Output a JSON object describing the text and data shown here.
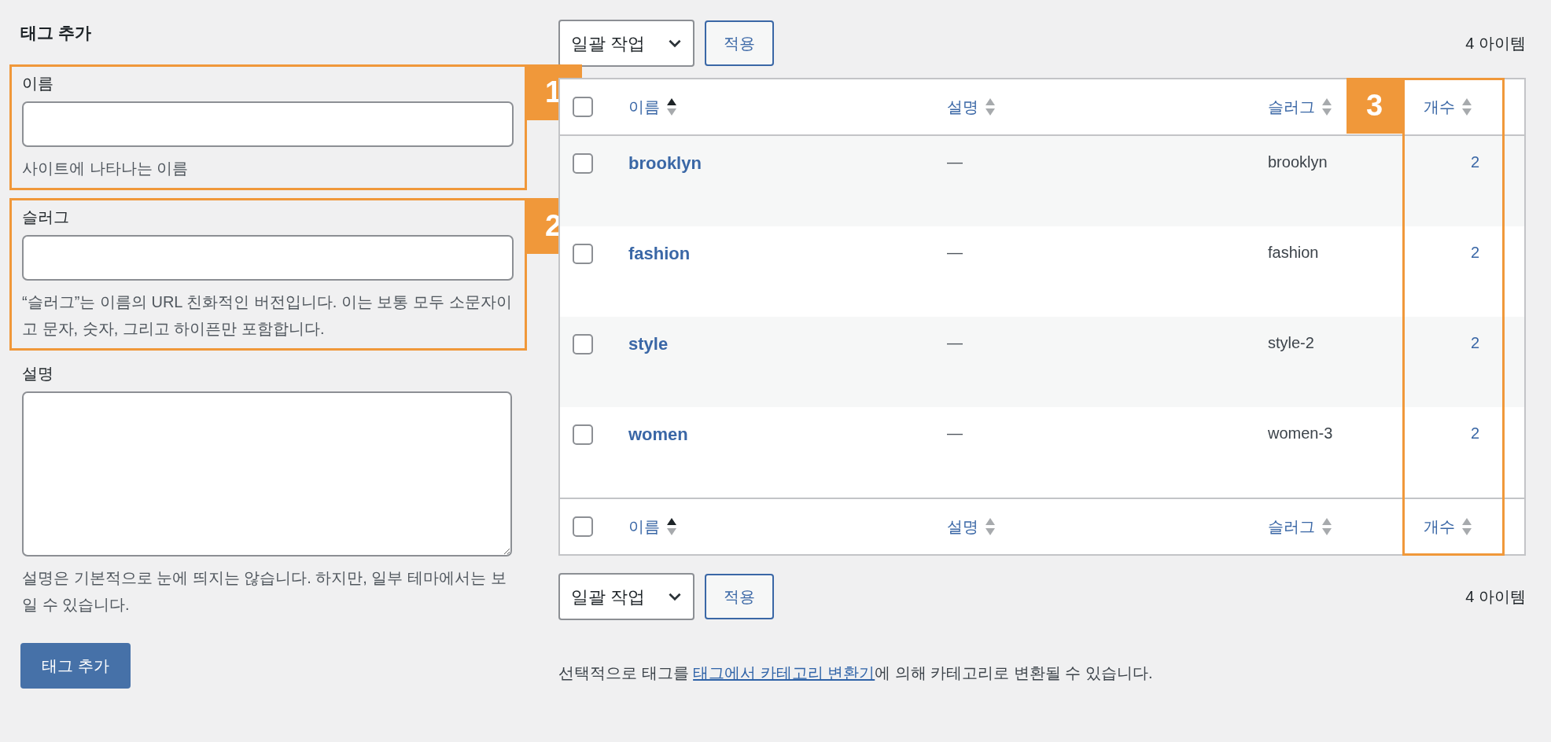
{
  "form": {
    "title": "태그 추가",
    "fields": [
      {
        "kind": "input",
        "label": "이름",
        "help": "사이트에 나타나는 이름",
        "annotation": "1"
      },
      {
        "kind": "input",
        "label": "슬러그",
        "help": "“슬러그”는 이름의 URL 친화적인 버전입니다. 이는 보통 모두 소문자이고 문자, 숫자, 그리고 하이픈만 포함합니다.",
        "annotation": "2"
      },
      {
        "kind": "textarea",
        "label": "설명",
        "help": "설명은 기본적으로 눈에 띄지는 않습니다. 하지만, 일부 테마에서는 보일 수 있습니다."
      }
    ],
    "submit": "태그 추가"
  },
  "top_nav": {
    "bulk_action": "일괄 작업",
    "apply": "적용",
    "count": "4 아이템"
  },
  "table": {
    "annotation": "3",
    "header": [
      {
        "label": "이름",
        "sort_active": true
      },
      {
        "label": "설명",
        "sort_active": false
      },
      {
        "label": "슬러그",
        "sort_active": false
      },
      {
        "label": "개수",
        "sort_active": false
      }
    ],
    "header_checked": false,
    "rows": [
      {
        "checked": false,
        "name": "brooklyn",
        "description": "—",
        "slug": "brooklyn",
        "count": "2"
      },
      {
        "checked": false,
        "name": "fashion",
        "description": "—",
        "slug": "fashion",
        "count": "2"
      },
      {
        "checked": false,
        "name": "style",
        "description": "—",
        "slug": "style-2",
        "count": "2"
      },
      {
        "checked": false,
        "name": "women",
        "description": "—",
        "slug": "women-3",
        "count": "2"
      }
    ],
    "footer": [
      {
        "label": "이름",
        "sort_active": true
      },
      {
        "label": "설명",
        "sort_active": false
      },
      {
        "label": "슬러그",
        "sort_active": false
      },
      {
        "label": "개수",
        "sort_active": false
      }
    ],
    "footer_checked": false
  },
  "bottom_nav": {
    "bulk_action": "일괄 작업",
    "apply": "적용",
    "count": "4 아이템"
  },
  "note": {
    "before": "선택적으로 태그를 ",
    "link": "태그에서 카테고리 변환기",
    "after": "에 의해 카테고리로 변환될 수 있습니다."
  }
}
